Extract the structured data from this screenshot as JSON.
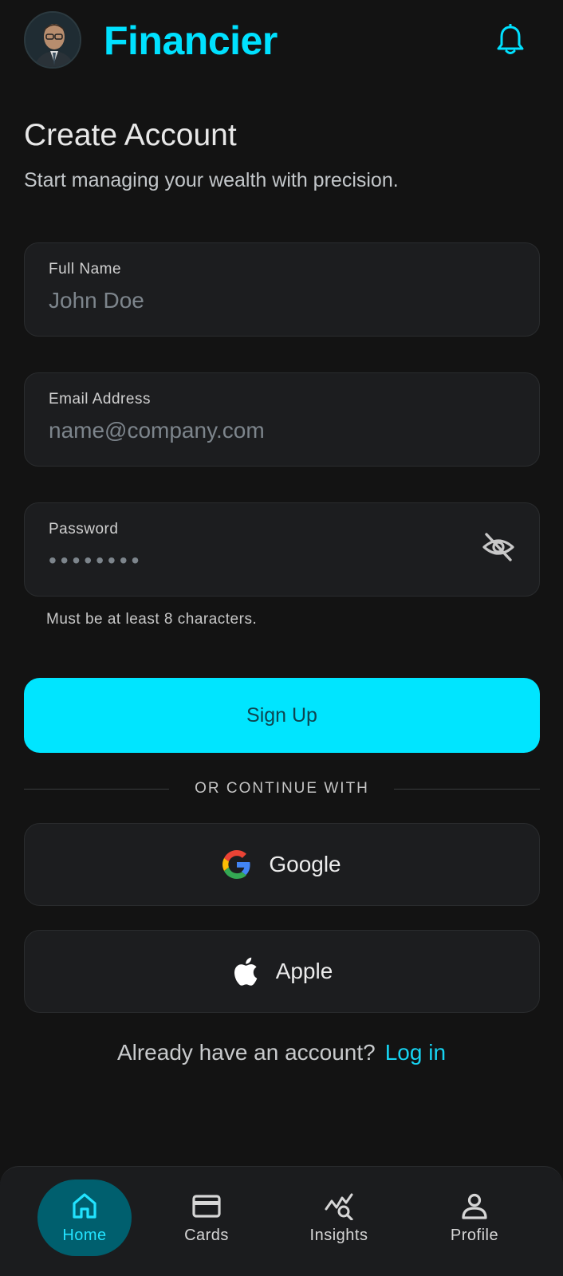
{
  "header": {
    "brand": "Financier",
    "accent_color": "#00e1ff",
    "avatar_icon": "user-photo",
    "notification_icon": "bell-icon"
  },
  "page": {
    "title": "Create Account",
    "subtitle": "Start managing your wealth with precision."
  },
  "form": {
    "full_name": {
      "label": "Full Name",
      "placeholder": "John Doe"
    },
    "email": {
      "label": "Email Address",
      "placeholder": "name@company.com"
    },
    "password": {
      "label": "Password",
      "value": "••••••••",
      "toggle_icon": "eye-off-icon"
    },
    "password_hint": "Must be at least 8 characters.",
    "submit_label": "Sign Up",
    "submit_color": "#00e5ff"
  },
  "divider_text": "OR CONTINUE WITH",
  "social": {
    "google_label": "Google",
    "apple_label": "Apple"
  },
  "login": {
    "prompt": "Already have an account?",
    "link": "Log in"
  },
  "nav": {
    "items": [
      {
        "label": "Home",
        "icon": "home-icon",
        "active": true
      },
      {
        "label": "Cards",
        "icon": "card-icon",
        "active": false
      },
      {
        "label": "Insights",
        "icon": "insights-icon",
        "active": false
      },
      {
        "label": "Profile",
        "icon": "profile-icon",
        "active": false
      }
    ]
  }
}
